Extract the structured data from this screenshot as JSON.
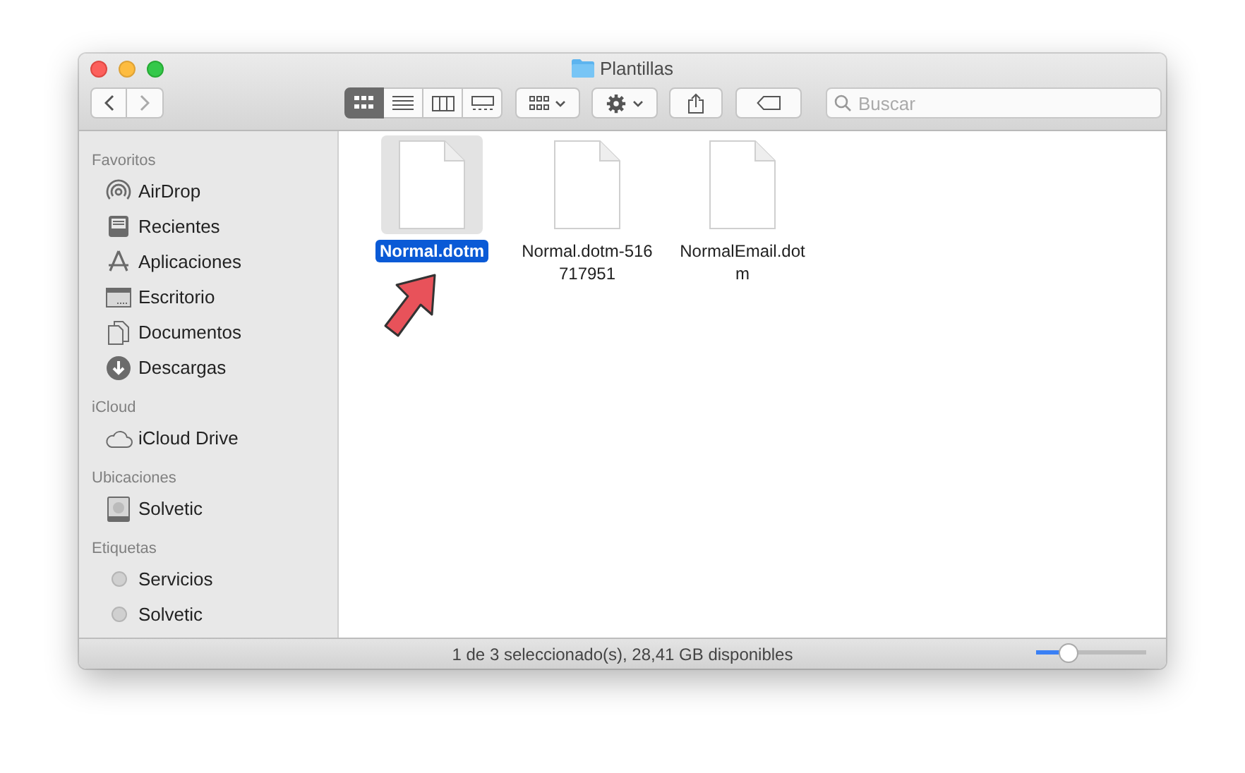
{
  "window": {
    "title": "Plantillas"
  },
  "toolbar": {
    "view_modes": [
      {
        "kind": "icons",
        "selected": true
      },
      {
        "kind": "list",
        "selected": false
      },
      {
        "kind": "columns",
        "selected": false
      },
      {
        "kind": "gallery",
        "selected": false
      }
    ],
    "search": {
      "placeholder": "Buscar"
    }
  },
  "sidebar": {
    "sections": [
      {
        "title": "Favoritos",
        "items": [
          {
            "label": "AirDrop",
            "kind": "airdrop"
          },
          {
            "label": "Recientes",
            "kind": "recents"
          },
          {
            "label": "Aplicaciones",
            "kind": "apps"
          },
          {
            "label": "Escritorio",
            "kind": "desktop"
          },
          {
            "label": "Documentos",
            "kind": "documents"
          },
          {
            "label": "Descargas",
            "kind": "downloads"
          }
        ]
      },
      {
        "title": "iCloud",
        "items": [
          {
            "label": "iCloud Drive",
            "kind": "cloud"
          }
        ]
      },
      {
        "title": "Ubicaciones",
        "items": [
          {
            "label": "Solvetic",
            "kind": "disk"
          }
        ]
      },
      {
        "title": "Etiquetas",
        "items": [
          {
            "label": "Servicios",
            "kind": "tag",
            "color": "#d0d0d0"
          },
          {
            "label": "Solvetic",
            "kind": "tag",
            "color": "#d0d0d0"
          }
        ]
      }
    ]
  },
  "files": [
    {
      "name": "Normal.dotm",
      "selected": true
    },
    {
      "name": "Normal.dotm-516717951",
      "selected": false
    },
    {
      "name": "NormalEmail.dotm",
      "selected": false
    }
  ],
  "status_bar": {
    "text": "1 de 3 seleccionado(s), 28,41 GB disponibles",
    "zoom": {
      "level": 0.25
    }
  }
}
